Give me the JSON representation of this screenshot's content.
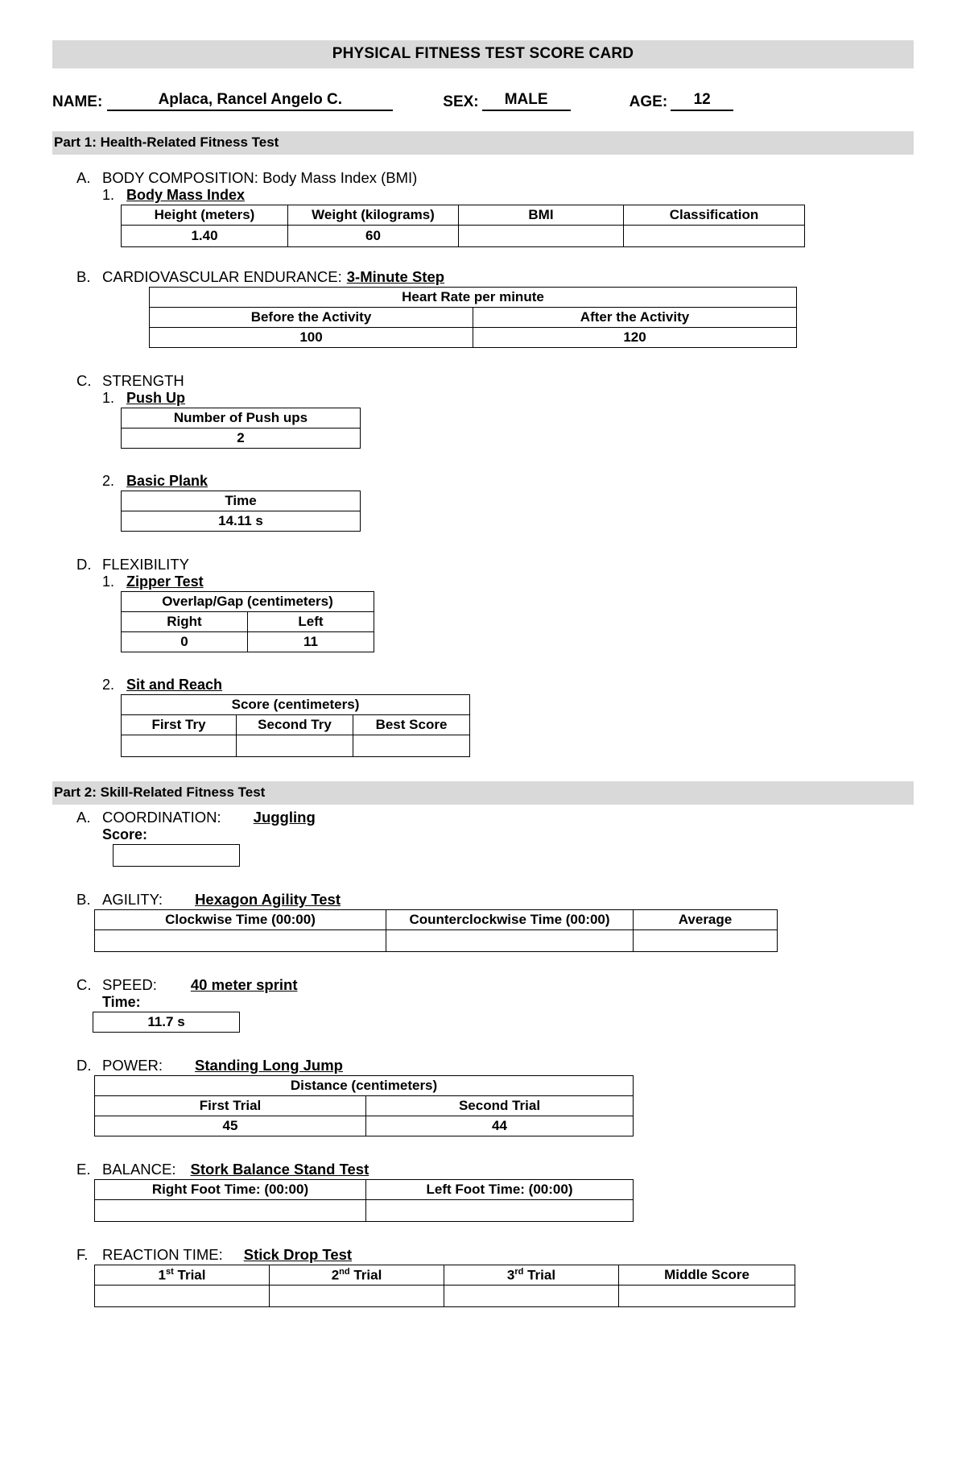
{
  "document": {
    "title": "PHYSICAL FITNESS TEST SCORE CARD"
  },
  "student": {
    "name_label": "NAME:",
    "name_value": "Aplaca, Rancel Angelo C.",
    "sex_label": "SEX:",
    "sex_value": "MALE",
    "age_label": "AGE:",
    "age_value": "12"
  },
  "part1": {
    "banner": "Part 1: Health-Related Fitness Test",
    "a": {
      "letter": "A.",
      "title": "BODY COMPOSITION: Body Mass Index (BMI)",
      "item1_num": "1.",
      "item1_title": "Body Mass Index",
      "table": {
        "headers": [
          "Height (meters)",
          "Weight (kilograms)",
          "BMI",
          "Classification"
        ],
        "values": [
          "1.40",
          "60",
          "",
          ""
        ]
      }
    },
    "b": {
      "letter": "B.",
      "title": "CARDIOVASCULAR ENDURANCE:",
      "test": "3-Minute Step",
      "table": {
        "span_header": "Heart Rate per minute",
        "headers": [
          "Before the Activity",
          "After the Activity"
        ],
        "values": [
          "100",
          "120"
        ]
      }
    },
    "c": {
      "letter": "C.",
      "title": "STRENGTH",
      "item1_num": "1.",
      "item1_title": "Push Up",
      "item1_table": {
        "headers": [
          "Number of Push ups"
        ],
        "values": [
          "2"
        ]
      },
      "item2_num": "2.",
      "item2_title": "Basic Plank",
      "item2_table": {
        "headers": [
          "Time"
        ],
        "values": [
          "14.11 s"
        ]
      }
    },
    "d": {
      "letter": "D.",
      "title": "FLEXIBILITY",
      "item1_num": "1.",
      "item1_title": "Zipper Test",
      "item1_table": {
        "span_header": "Overlap/Gap (centimeters)",
        "headers": [
          "Right",
          "Left"
        ],
        "values": [
          "0",
          "11"
        ]
      },
      "item2_num": "2.",
      "item2_title": "Sit and Reach",
      "item2_table": {
        "span_header": "Score (centimeters)",
        "headers": [
          "First Try",
          "Second Try",
          "Best Score"
        ],
        "values": [
          "",
          "",
          ""
        ]
      }
    }
  },
  "part2": {
    "banner": "Part 2: Skill-Related Fitness Test",
    "a": {
      "letter": "A.",
      "title": "COORDINATION:",
      "test": "Juggling",
      "score_label": "Score:",
      "score_value": ""
    },
    "b": {
      "letter": "B.",
      "title": "AGILITY:",
      "test": "Hexagon Agility Test",
      "table": {
        "headers": [
          "Clockwise Time (00:00)",
          "Counterclockwise Time (00:00)",
          "Average"
        ],
        "values": [
          "",
          "",
          ""
        ]
      }
    },
    "c": {
      "letter": "C.",
      "title": "SPEED:",
      "test": "40 meter sprint",
      "time_label": "Time:",
      "time_value": "11.7 s"
    },
    "d": {
      "letter": "D.",
      "title": "POWER:",
      "test": "Standing Long Jump",
      "table": {
        "span_header": "Distance (centimeters)",
        "headers": [
          "First Trial",
          "Second Trial"
        ],
        "values": [
          "45",
          "44"
        ]
      }
    },
    "e": {
      "letter": "E.",
      "title": "BALANCE:",
      "test": "Stork Balance Stand Test",
      "table": {
        "headers": [
          "Right Foot Time: (00:00)",
          "Left Foot Time: (00:00)"
        ],
        "values": [
          "",
          ""
        ]
      }
    },
    "f": {
      "letter": "F.",
      "title": "REACTION TIME:",
      "test": "Stick Drop Test",
      "table": {
        "headers_html": [
          "1<sup>st</sup> Trial",
          "2<sup>nd</sup> Trial",
          "3<sup>rd</sup> Trial",
          "Middle Score"
        ],
        "values": [
          "",
          "",
          "",
          ""
        ]
      }
    }
  }
}
